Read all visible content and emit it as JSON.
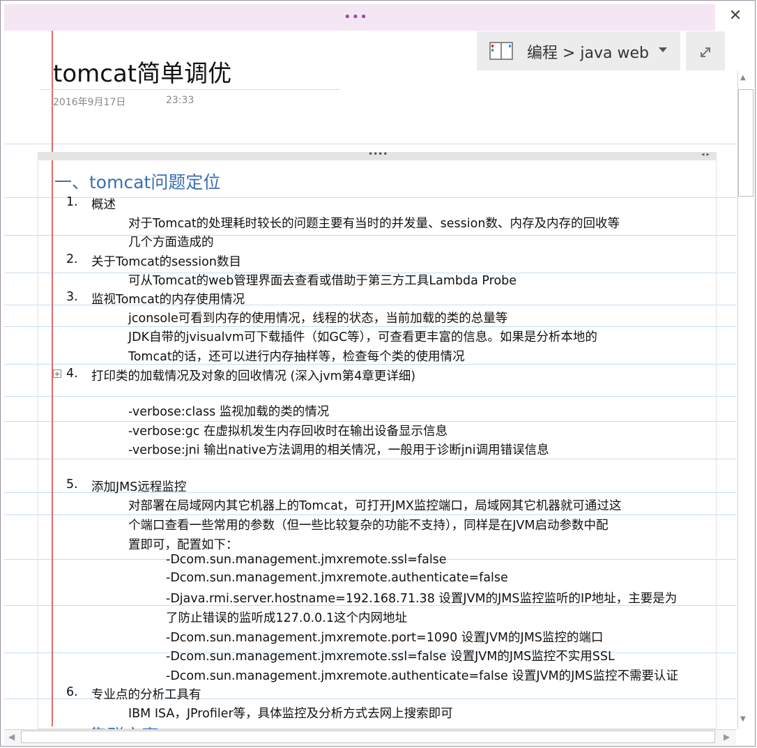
{
  "window": {
    "grip": "•••",
    "close": "✕"
  },
  "page": {
    "title": "tomcat简单调优",
    "date": "2016年9月17日",
    "time": "23:33"
  },
  "notebook": {
    "icon": "notebook-icon",
    "path": "编程 > java web",
    "dropdown": "chevron-down-icon",
    "expand": "expand-icon"
  },
  "container": {
    "grip": "••••",
    "arrows": "◂ ▸"
  },
  "content": {
    "heading1": "一、tomcat问题定位",
    "lines": [
      {
        "num": "1.",
        "text": "概述"
      },
      {
        "num": "",
        "text": "对于Tomcat的处理耗时较长的问题主要有当时的并发量、session数、内存及内存的回收等"
      },
      {
        "num": "",
        "text": "几个方面造成的"
      },
      {
        "num": "2.",
        "text": "关于Tomcat的session数目"
      },
      {
        "num": "",
        "text": "可从Tomcat的web管理界面去查看或借助于第三方工具Lambda Probe"
      },
      {
        "num": "3.",
        "text": "监视Tomcat的内存使用情况"
      },
      {
        "num": "",
        "text": "jconsole可看到内存的使用情况，线程的状态，当前加载的类的总量等"
      },
      {
        "num": "",
        "text": "JDK自带的jvisualvm可下载插件（如GC等），可查看更丰富的信息。如果是分析本地的"
      },
      {
        "num": "",
        "text": "Tomcat的话，还可以进行内存抽样等，检查每个类的使用情况"
      },
      {
        "num": "4.",
        "text": "打印类的加载情况及对象的回收情况 (深入jvm第4章更详细)"
      },
      {
        "num": "",
        "text": "-verbose:class 监视加载的类的情况"
      },
      {
        "num": "",
        "text": "-verbose:gc 在虚拟机发生内存回收时在输出设备显示信息"
      },
      {
        "num": "",
        "text": "-verbose:jni 输出native方法调用的相关情况，一般用于诊断jni调用错误信息"
      },
      {
        "num": "5.",
        "text": "添加JMS远程监控"
      },
      {
        "num": "",
        "text": "对部署在局域网内其它机器上的Tomcat，可打开JMX监控端口，局域网其它机器就可通过这"
      },
      {
        "num": "",
        "text": "个端口查看一些常用的参数（但一些比较复杂的功能不支持），同样是在JVM启动参数中配"
      },
      {
        "num": "",
        "text": "置即可，配置如下："
      },
      {
        "num": "",
        "text": "-Dcom.sun.management.jmxremote.ssl=false"
      },
      {
        "num": "",
        "text": "-Dcom.sun.management.jmxremote.authenticate=false"
      },
      {
        "num": "",
        "text": "-Djava.rmi.server.hostname=192.168.71.38 设置JVM的JMS监控监听的IP地址，主要是为"
      },
      {
        "num": "",
        "text": "了防止错误的监听成127.0.0.1这个内网地址"
      },
      {
        "num": "",
        "text": "-Dcom.sun.management.jmxremote.port=1090 设置JVM的JMS监控的端口"
      },
      {
        "num": "",
        "text": "-Dcom.sun.management.jmxremote.ssl=false 设置JVM的JMS监控不实用SSL"
      },
      {
        "num": "",
        "text": "-Dcom.sun.management.jmxremote.authenticate=false 设置JVM的JMS监控不需要认证"
      },
      {
        "num": "6.",
        "text": "专业点的分析工具有"
      },
      {
        "num": "",
        "text": "IBM ISA，JProfiler等，具体监控及分析方式去网上搜索即可"
      }
    ],
    "heading2": "二、集群方案",
    "expander": "+"
  },
  "scrollbars": {
    "up": "▲",
    "down": "▼",
    "left": "◀",
    "right": "▶"
  }
}
